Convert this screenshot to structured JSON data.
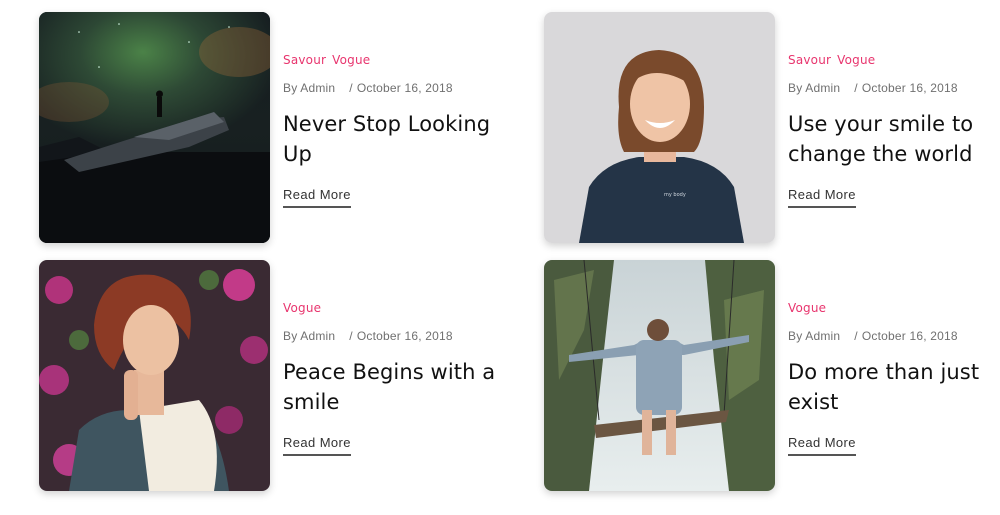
{
  "posts": [
    {
      "categories": [
        "Savour",
        "Vogue"
      ],
      "author": "By Admin",
      "date_sep": "/",
      "date": "October 16, 2018",
      "title": "Never Stop Looking Up",
      "read_more": "Read More"
    },
    {
      "categories": [
        "Savour",
        "Vogue"
      ],
      "author": "By Admin",
      "date_sep": "/",
      "date": "October 16, 2018",
      "title": "Use your smile to change the world",
      "read_more": "Read More"
    },
    {
      "categories": [
        "Vogue"
      ],
      "author": "By Admin",
      "date_sep": "/",
      "date": "October 16, 2018",
      "title": "Peace Begins with a smile",
      "read_more": "Read More"
    },
    {
      "categories": [
        "Vogue"
      ],
      "author": "By Admin",
      "date_sep": "/",
      "date": "October 16, 2018",
      "title": "Do more than just exist",
      "read_more": "Read More"
    }
  ],
  "colors": {
    "category_accent": "#e8356e",
    "title_text": "#111111",
    "meta_text": "#707070"
  }
}
